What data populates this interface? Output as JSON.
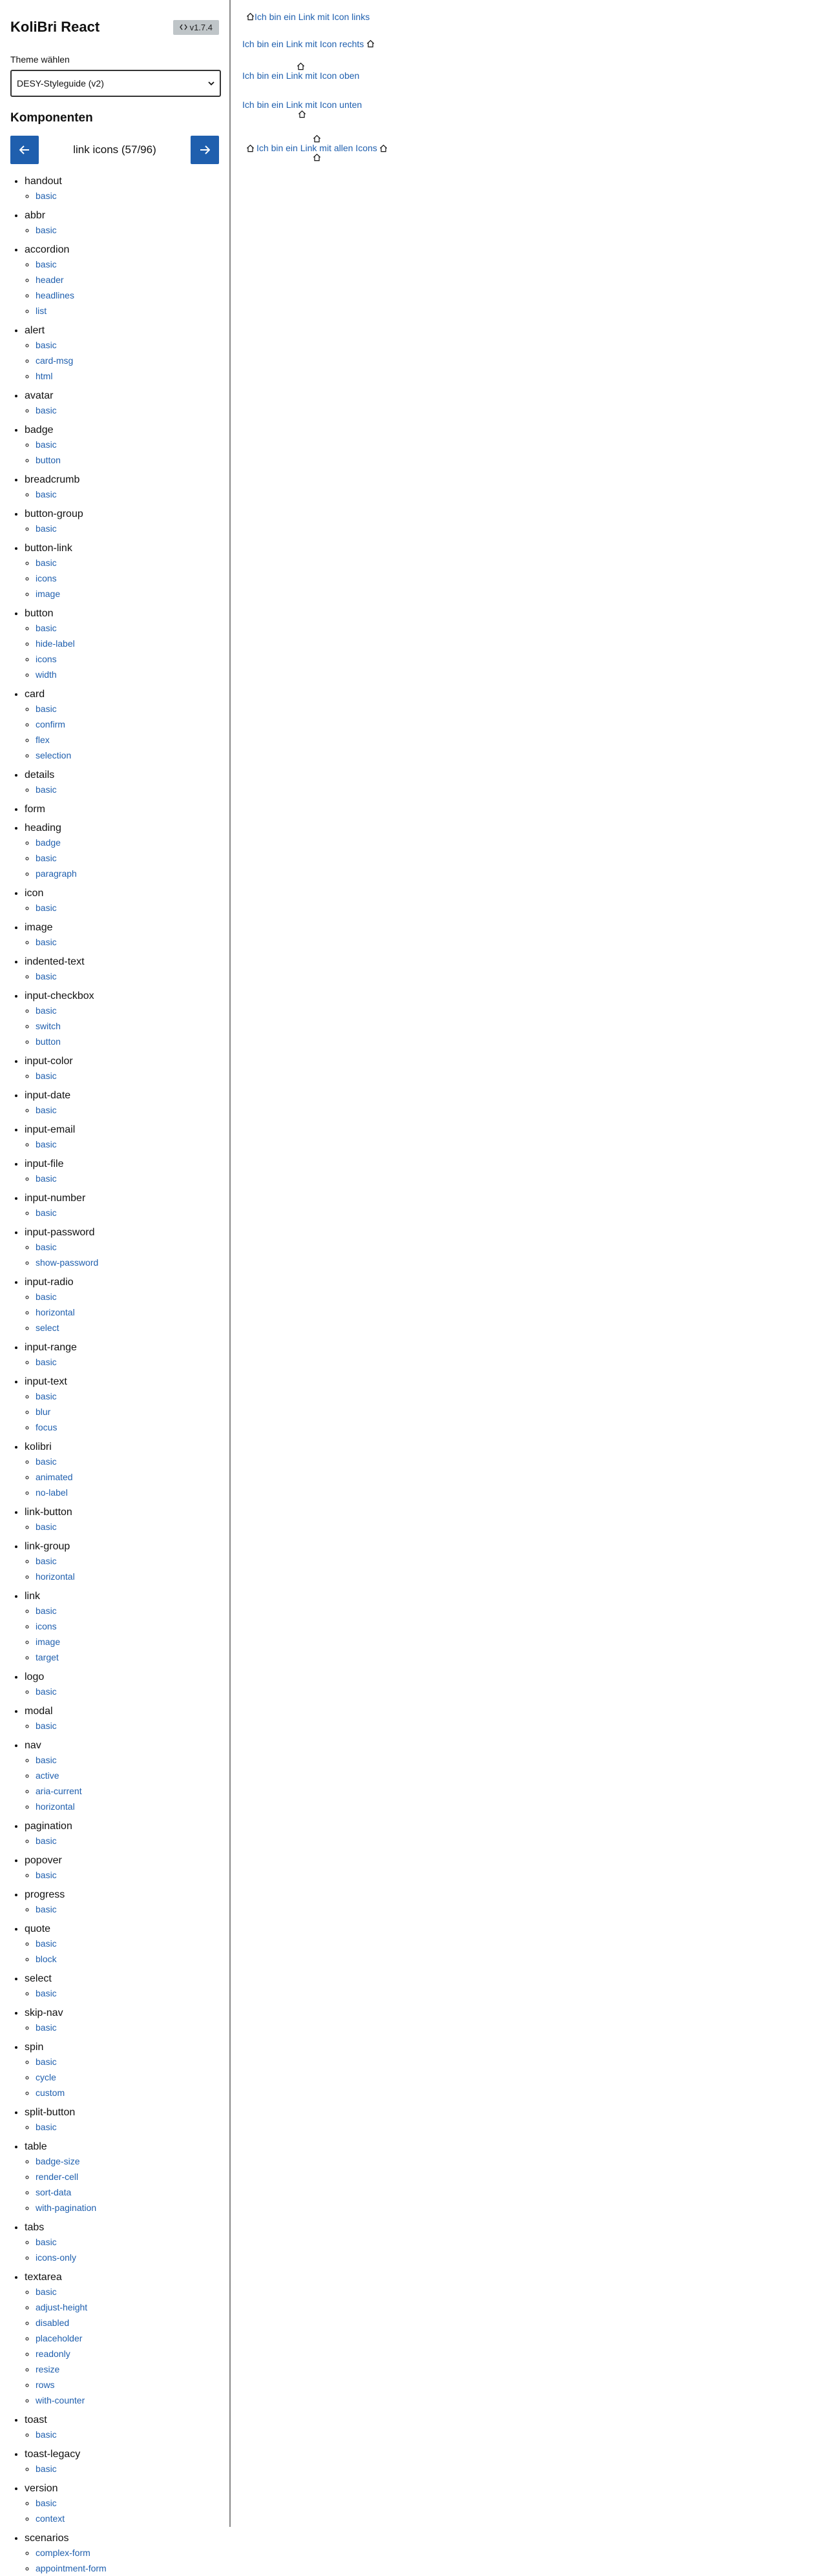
{
  "app": {
    "title": "KoliBri React",
    "version": "v1.7.4"
  },
  "theme": {
    "label": "Theme wählen",
    "selected": "DESY-Styleguide (v2)"
  },
  "components_title": "Komponenten",
  "pager": {
    "label": "link icons (57/96)",
    "prev_icon": "arrow-left-icon",
    "next_icon": "arrow-right-icon"
  },
  "components": [
    {
      "name": "handout",
      "subs": [
        "basic"
      ]
    },
    {
      "name": "abbr",
      "subs": [
        "basic"
      ]
    },
    {
      "name": "accordion",
      "subs": [
        "basic",
        "header",
        "headlines",
        "list"
      ]
    },
    {
      "name": "alert",
      "subs": [
        "basic",
        "card-msg",
        "html"
      ]
    },
    {
      "name": "avatar",
      "subs": [
        "basic"
      ]
    },
    {
      "name": "badge",
      "subs": [
        "basic",
        "button"
      ]
    },
    {
      "name": "breadcrumb",
      "subs": [
        "basic"
      ]
    },
    {
      "name": "button-group",
      "subs": [
        "basic"
      ]
    },
    {
      "name": "button-link",
      "subs": [
        "basic",
        "icons",
        "image"
      ]
    },
    {
      "name": "button",
      "subs": [
        "basic",
        "hide-label",
        "icons",
        "width"
      ]
    },
    {
      "name": "card",
      "subs": [
        "basic",
        "confirm",
        "flex",
        "selection"
      ]
    },
    {
      "name": "details",
      "subs": [
        "basic"
      ]
    },
    {
      "name": "form",
      "subs": []
    },
    {
      "name": "heading",
      "subs": [
        "badge",
        "basic",
        "paragraph"
      ]
    },
    {
      "name": "icon",
      "subs": [
        "basic"
      ]
    },
    {
      "name": "image",
      "subs": [
        "basic"
      ]
    },
    {
      "name": "indented-text",
      "subs": [
        "basic"
      ]
    },
    {
      "name": "input-checkbox",
      "subs": [
        "basic",
        "switch",
        "button"
      ]
    },
    {
      "name": "input-color",
      "subs": [
        "basic"
      ]
    },
    {
      "name": "input-date",
      "subs": [
        "basic"
      ]
    },
    {
      "name": "input-email",
      "subs": [
        "basic"
      ]
    },
    {
      "name": "input-file",
      "subs": [
        "basic"
      ]
    },
    {
      "name": "input-number",
      "subs": [
        "basic"
      ]
    },
    {
      "name": "input-password",
      "subs": [
        "basic",
        "show-password"
      ]
    },
    {
      "name": "input-radio",
      "subs": [
        "basic",
        "horizontal",
        "select"
      ]
    },
    {
      "name": "input-range",
      "subs": [
        "basic"
      ]
    },
    {
      "name": "input-text",
      "subs": [
        "basic",
        "blur",
        "focus"
      ]
    },
    {
      "name": "kolibri",
      "subs": [
        "basic",
        "animated",
        "no-label"
      ]
    },
    {
      "name": "link-button",
      "subs": [
        "basic"
      ]
    },
    {
      "name": "link-group",
      "subs": [
        "basic",
        "horizontal"
      ]
    },
    {
      "name": "link",
      "subs": [
        "basic",
        "icons",
        "image",
        "target"
      ]
    },
    {
      "name": "logo",
      "subs": [
        "basic"
      ]
    },
    {
      "name": "modal",
      "subs": [
        "basic"
      ]
    },
    {
      "name": "nav",
      "subs": [
        "basic",
        "active",
        "aria-current",
        "horizontal"
      ]
    },
    {
      "name": "pagination",
      "subs": [
        "basic"
      ]
    },
    {
      "name": "popover",
      "subs": [
        "basic"
      ]
    },
    {
      "name": "progress",
      "subs": [
        "basic"
      ]
    },
    {
      "name": "quote",
      "subs": [
        "basic",
        "block"
      ]
    },
    {
      "name": "select",
      "subs": [
        "basic"
      ]
    },
    {
      "name": "skip-nav",
      "subs": [
        "basic"
      ]
    },
    {
      "name": "spin",
      "subs": [
        "basic",
        "cycle",
        "custom"
      ]
    },
    {
      "name": "split-button",
      "subs": [
        "basic"
      ]
    },
    {
      "name": "table",
      "subs": [
        "badge-size",
        "render-cell",
        "sort-data",
        "with-pagination"
      ]
    },
    {
      "name": "tabs",
      "subs": [
        "basic",
        "icons-only"
      ]
    },
    {
      "name": "textarea",
      "subs": [
        "basic",
        "adjust-height",
        "disabled",
        "placeholder",
        "readonly",
        "resize",
        "rows",
        "with-counter"
      ]
    },
    {
      "name": "toast",
      "subs": [
        "basic"
      ]
    },
    {
      "name": "toast-legacy",
      "subs": [
        "basic"
      ]
    },
    {
      "name": "version",
      "subs": [
        "basic",
        "context"
      ]
    },
    {
      "name": "scenarios",
      "subs": [
        "complex-form",
        "appointment-form"
      ]
    }
  ],
  "demo_links": {
    "left": "Ich bin ein Link mit Icon links",
    "right": "Ich bin ein Link mit Icon rechts",
    "top": "Ich bin ein Link mit Icon oben",
    "bottom": "Ich bin ein Link mit Icon unten",
    "all": "Ich bin ein Link mit allen Icons",
    "icon": "house-icon"
  },
  "colors": {
    "link": "#1f5fae",
    "pager_button": "#1f5fae",
    "version_badge": "#bfc5c8"
  }
}
